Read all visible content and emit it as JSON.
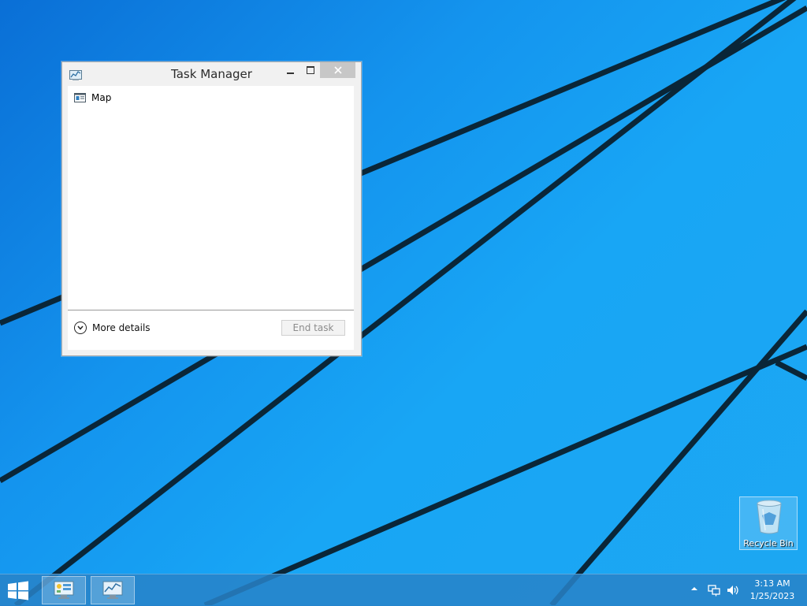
{
  "window": {
    "title": "Task Manager",
    "tasks": [
      {
        "label": "Map"
      }
    ],
    "more_details_label": "More details",
    "end_task_label": "End task"
  },
  "desktop": {
    "recycle_bin_label": "Recycle Bin"
  },
  "taskbar": {
    "time": "3:13 AM",
    "date": "1/25/2023"
  },
  "colors": {
    "wallpaper_blue": "#1494ee",
    "stripe_dark": "#0b2a3c",
    "taskbar": "#2882c8"
  }
}
